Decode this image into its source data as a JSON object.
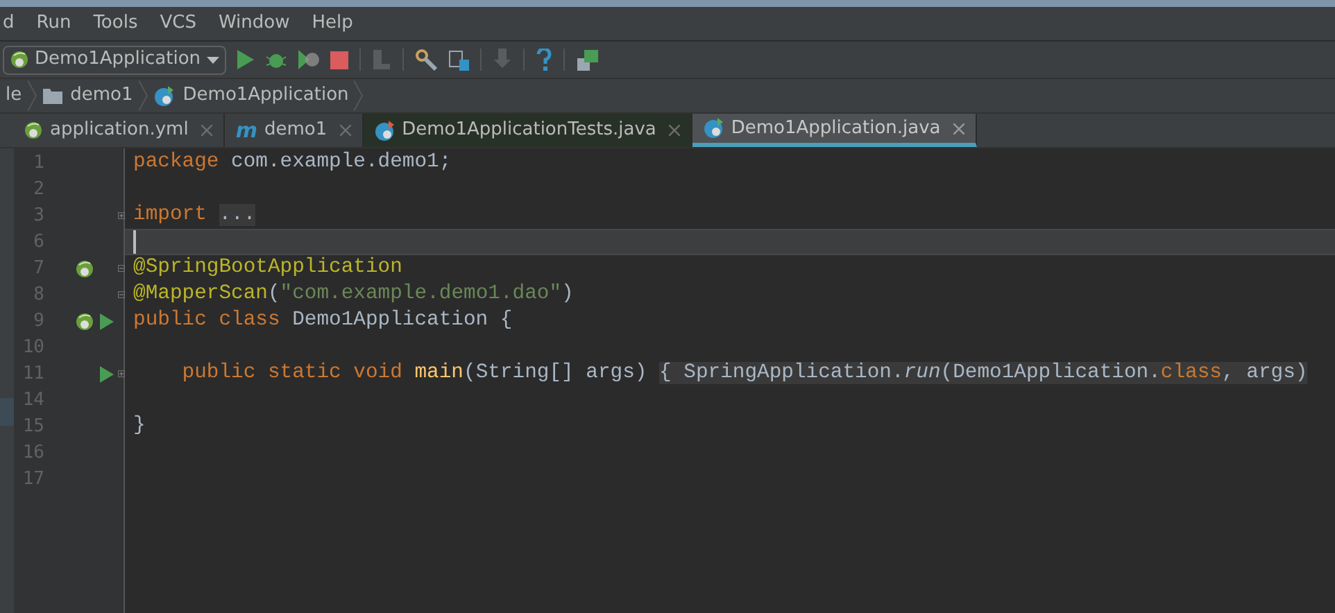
{
  "menu": [
    "d",
    "Run",
    "Tools",
    "VCS",
    "Window",
    "Help"
  ],
  "toolbar": {
    "run_config": "Demo1Application"
  },
  "breadcrumbs": [
    {
      "label": "le",
      "kind": "plain"
    },
    {
      "label": "demo1",
      "kind": "folder"
    },
    {
      "label": "Demo1Application",
      "kind": "class"
    }
  ],
  "tabs": [
    {
      "label": "application.yml",
      "kind": "spring",
      "selected": false
    },
    {
      "label": "demo1",
      "kind": "maven",
      "icon_letter": "m",
      "selected": false
    },
    {
      "label": "Demo1ApplicationTests.java",
      "kind": "test",
      "selected": false
    },
    {
      "label": "Demo1Application.java",
      "kind": "class",
      "selected": true
    }
  ],
  "lines": [
    {
      "number": "1",
      "current": false,
      "tokens": [
        {
          "kind": "keyword",
          "text": "package "
        },
        {
          "kind": "plain",
          "text": "com.example.demo1;"
        }
      ]
    },
    {
      "number": "2",
      "current": false
    },
    {
      "number": "3",
      "fold": {
        "kind": "expand"
      },
      "current": false,
      "tokens": [
        {
          "kind": "keyword",
          "text": "import "
        },
        {
          "kind": "folded",
          "text": "..."
        }
      ]
    },
    {
      "number": "6",
      "current": true
    },
    {
      "number": "7",
      "gutter": [
        {
          "kind": "bean"
        }
      ],
      "fold": {
        "kind": "collapse"
      },
      "current": false,
      "tokens": [
        {
          "kind": "annotation",
          "text": "@SpringBootApplication"
        }
      ]
    },
    {
      "number": "8",
      "fold": {
        "kind": "collapse"
      },
      "current": false,
      "tokens": [
        {
          "kind": "annotation",
          "text": "@MapperScan"
        },
        {
          "kind": "plain",
          "text": "("
        },
        {
          "kind": "string",
          "text": "\"com.example.demo1.dao\""
        },
        {
          "kind": "plain",
          "text": ")"
        }
      ]
    },
    {
      "number": "9",
      "gutter": [
        {
          "kind": "spring"
        },
        {
          "kind": "run"
        }
      ],
      "current": false,
      "tokens": [
        {
          "kind": "keyword",
          "text": "public class "
        },
        {
          "kind": "plain",
          "text": "Demo1Application {"
        }
      ]
    },
    {
      "number": "10",
      "current": false
    },
    {
      "number": "11",
      "gutter": [
        {
          "kind": "run"
        }
      ],
      "fold": {
        "kind": "expand"
      },
      "current": false,
      "tokens": [
        {
          "kind": "keyword",
          "text": "    public static void "
        },
        {
          "kind": "method",
          "text": "main"
        },
        {
          "kind": "plain",
          "text": "(String[] args) "
        },
        {
          "kind": "folded",
          "text": "{ SpringApplication."
        },
        {
          "kind": "italic-folded",
          "text": "run"
        },
        {
          "kind": "folded",
          "text": "(Demo1Application."
        },
        {
          "kind": "keyword-folded",
          "text": "class"
        },
        {
          "kind": "folded",
          "text": ", args)"
        }
      ]
    },
    {
      "number": "14",
      "current": false
    },
    {
      "number": "15",
      "current": false,
      "tokens": [
        {
          "kind": "plain",
          "text": "}"
        }
      ]
    },
    {
      "number": "16",
      "current": false
    },
    {
      "number": "17",
      "current": false
    }
  ]
}
